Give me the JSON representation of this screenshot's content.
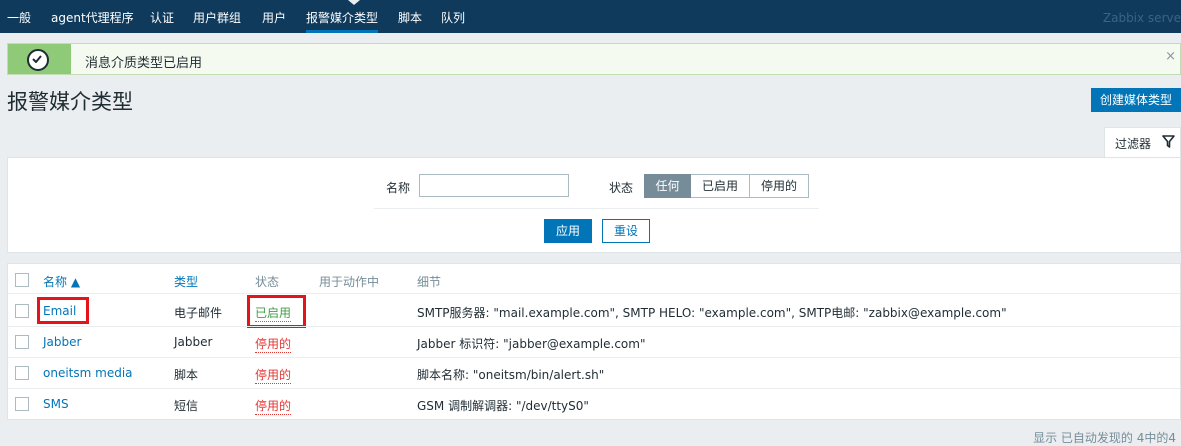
{
  "nav": {
    "items": [
      "一般",
      "agent代理程序",
      "认证",
      "用户群组",
      "用户",
      "报警媒介类型",
      "脚本",
      "队列"
    ],
    "active_index": 5,
    "server": "Zabbix serve"
  },
  "message": {
    "text": "消息介质类型已启用",
    "close": "×"
  },
  "page": {
    "title": "报警媒介类型",
    "create_button": "创建媒体类型"
  },
  "filter": {
    "tab_label": "过滤器",
    "name_label": "名称",
    "name_value": "",
    "status_label": "状态",
    "status_options": [
      "任何",
      "已启用",
      "停用的"
    ],
    "status_selected": "任何",
    "apply": "应用",
    "reset": "重设"
  },
  "table": {
    "columns": [
      "名称 ▲",
      "类型",
      "状态",
      "用于动作中",
      "细节"
    ],
    "rows": [
      {
        "name": "Email",
        "type": "电子邮件",
        "status": "已启用",
        "used_in": "",
        "details": "SMTP服务器: \"mail.example.com\", SMTP HELO: \"example.com\", SMTP电邮: \"zabbix@example.com\""
      },
      {
        "name": "Jabber",
        "type": "Jabber",
        "status": "停用的",
        "used_in": "",
        "details": "Jabber 标识符: \"jabber@example.com\""
      },
      {
        "name": "oneitsm media",
        "type": "脚本",
        "status": "停用的",
        "used_in": "",
        "details": "脚本名称: \"oneitsm/bin/alert.sh\""
      },
      {
        "name": "SMS",
        "type": "短信",
        "status": "停用的",
        "used_in": "",
        "details": "GSM 调制解调器: \"/dev/ttyS0\""
      }
    ]
  },
  "footer": "显示 已自动发现的 4中的4",
  "colors": {
    "nav_bg": "#0f3a5c",
    "accent": "#0275b8",
    "enabled": "#429e47",
    "disabled": "#e33734",
    "highlight": "#e5141a"
  }
}
